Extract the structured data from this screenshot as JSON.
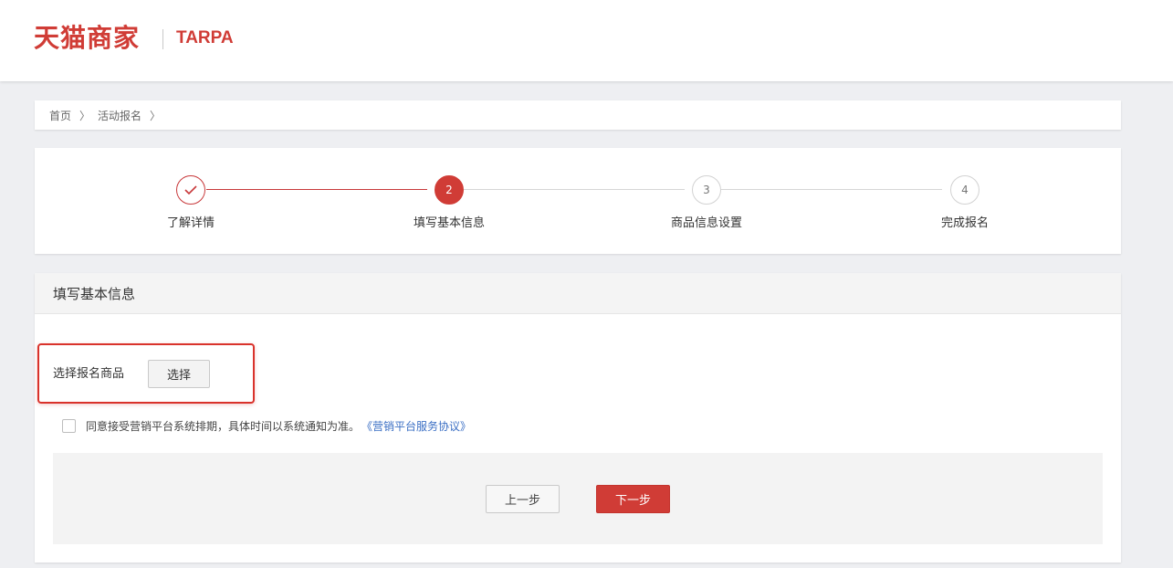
{
  "header": {
    "logo_text": "天猫商家",
    "sub_brand": "TARPA"
  },
  "breadcrumb": {
    "items": [
      "首页",
      "活动报名"
    ],
    "separator": "〉"
  },
  "steps": [
    {
      "number": "",
      "label": "了解详情",
      "state": "done",
      "icon": "check-icon"
    },
    {
      "number": "2",
      "label": "填写基本信息",
      "state": "active"
    },
    {
      "number": "3",
      "label": "商品信息设置",
      "state": "pending"
    },
    {
      "number": "4",
      "label": "完成报名",
      "state": "pending"
    }
  ],
  "form": {
    "title": "填写基本信息",
    "field_label": "选择报名商品",
    "select_button": "选择",
    "agreement_text": "同意接受营销平台系统排期，具体时间以系统通知为准。",
    "agreement_link": "《营销平台服务协议》",
    "agreement_checked": false,
    "prev_button": "上一步",
    "next_button": "下一步"
  },
  "colors": {
    "brand_red": "#d03c36",
    "link_blue": "#3b6fc4",
    "highlight_red": "#d9322b"
  }
}
